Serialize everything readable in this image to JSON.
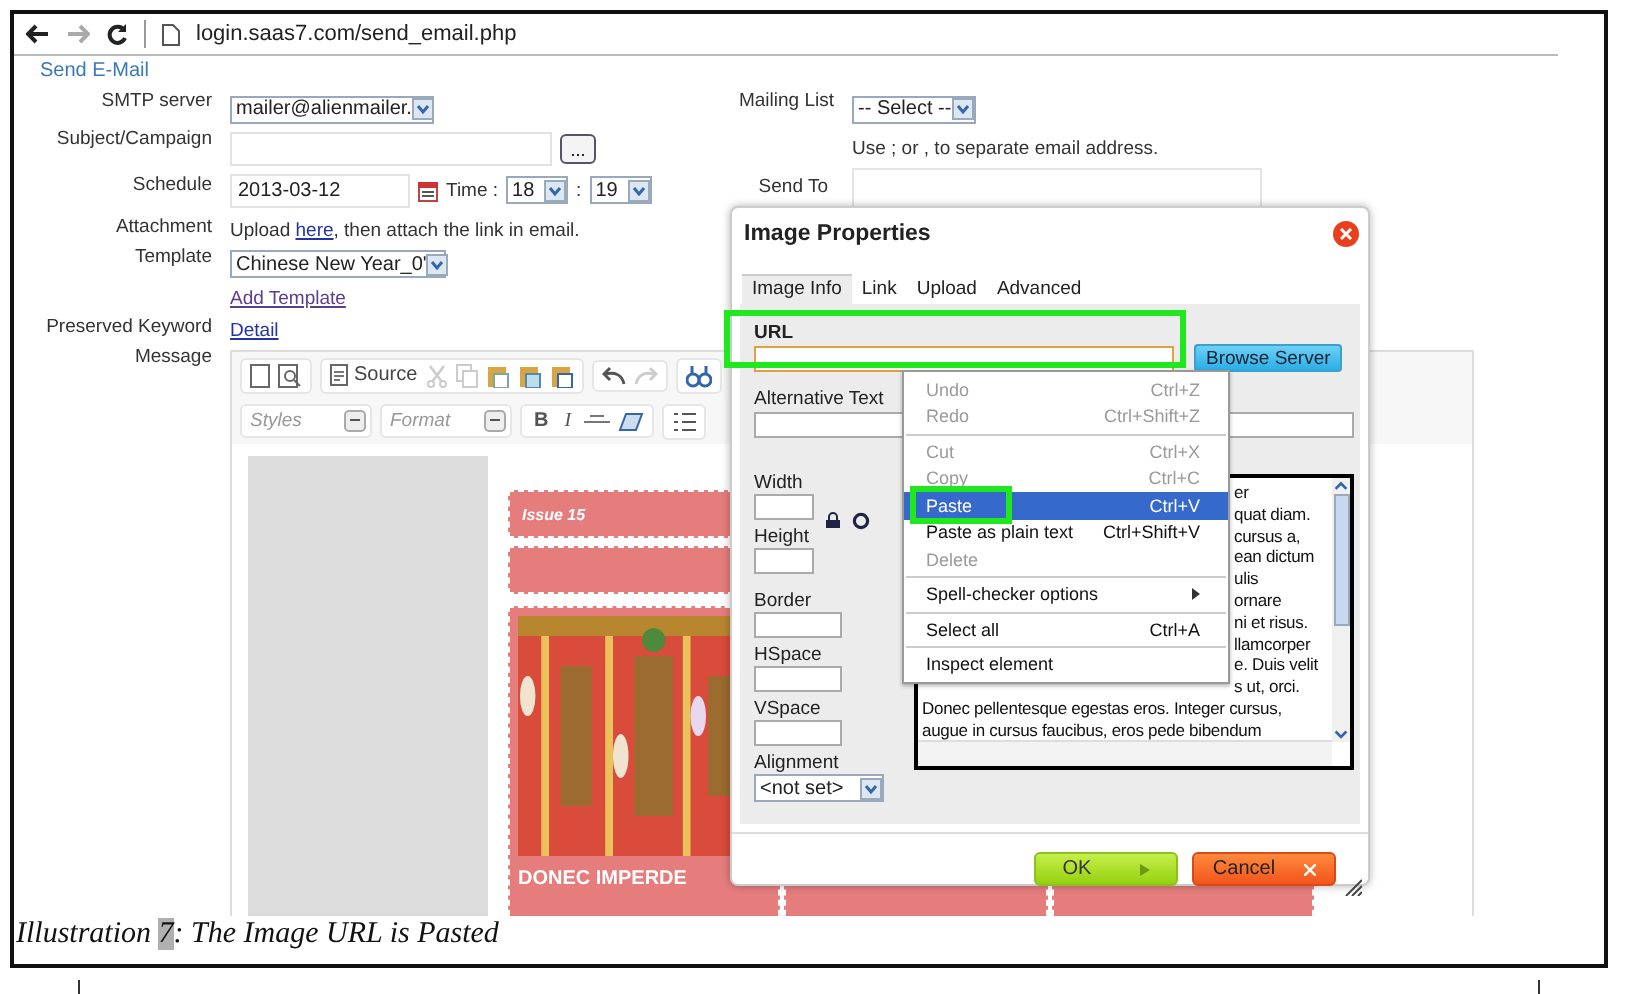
{
  "browser": {
    "url": "login.saas7.com/send_email.php"
  },
  "form": {
    "legend": "Send E-Mail",
    "smtp_server": {
      "label": "SMTP server",
      "value": "mailer@alienmailer."
    },
    "subject": {
      "label": "Subject/Campaign",
      "button": "..."
    },
    "schedule": {
      "label": "Schedule",
      "date": "2013-03-12",
      "time_label": "Time :",
      "hour": "18",
      "separator": ":",
      "minute": "19"
    },
    "attachment": {
      "label": "Attachment",
      "before": "Upload ",
      "link": "here",
      "after": ", then attach the link in email."
    },
    "template": {
      "label": "Template",
      "value": "Chinese New Year_0'",
      "link": "Add Template"
    },
    "preserved_keyword": {
      "label": "Preserved Keyword",
      "link": "Detail"
    },
    "message": {
      "label": "Message"
    },
    "mailing_list": {
      "label": "Mailing List",
      "value": "-- Select --"
    },
    "send_to": {
      "label": "Send To",
      "hint": "Use ; or , to separate email address."
    }
  },
  "editor": {
    "source_button": "Source",
    "styles": "Styles",
    "format": "Format",
    "bold": "B",
    "italic": "I",
    "issue": "Issue 15",
    "headline": "DONEC IMPERDE"
  },
  "dialog": {
    "title": "Image Properties",
    "tabs": [
      {
        "label": "Image Info",
        "selected": true
      },
      {
        "label": "Link",
        "selected": false
      },
      {
        "label": "Upload",
        "selected": false
      },
      {
        "label": "Advanced",
        "selected": false
      }
    ],
    "url": {
      "label": "URL",
      "highlighted": true
    },
    "browse_button": "Browse Server",
    "alt_text": {
      "label": "Alternative Text"
    },
    "width": {
      "label": "Width"
    },
    "height": {
      "label": "Height"
    },
    "border": {
      "label": "Border"
    },
    "hspace": {
      "label": "HSpace"
    },
    "vspace": {
      "label": "VSpace"
    },
    "alignment": {
      "label": "Alignment",
      "value": "<not set>"
    },
    "preview_lines": [
      {
        "kind": "partial",
        "text": "er"
      },
      {
        "kind": "partial",
        "text": "quat diam."
      },
      {
        "kind": "partial",
        "text": "cursus a,"
      },
      {
        "kind": "partial",
        "text": "ean dictum"
      },
      {
        "kind": "partial",
        "text": "ulis"
      },
      {
        "kind": "partial",
        "text": "ornare"
      },
      {
        "kind": "partial",
        "text": "ni et risus."
      },
      {
        "kind": "partial",
        "text": "llamcorper"
      },
      {
        "kind": "partial",
        "text": "e. Duis velit"
      },
      {
        "kind": "partial",
        "text": "s ut, orci."
      },
      {
        "kind": "full",
        "text": "Donec pellentesque egestas eros. Integer cursus,"
      },
      {
        "kind": "full",
        "text": "augue in cursus faucibus, eros pede bibendum"
      }
    ],
    "ok_button": "OK",
    "cancel_button": "Cancel"
  },
  "context_menu": {
    "items": [
      {
        "kind": "item",
        "label": "Undo",
        "shortcut": "Ctrl+Z",
        "disabled": true,
        "selected": false,
        "highlighted": false
      },
      {
        "kind": "item",
        "label": "Redo",
        "shortcut": "Ctrl+Shift+Z",
        "disabled": true,
        "selected": false,
        "highlighted": false
      },
      {
        "kind": "separator"
      },
      {
        "kind": "item",
        "label": "Cut",
        "shortcut": "Ctrl+X",
        "disabled": true,
        "selected": false,
        "highlighted": false
      },
      {
        "kind": "item",
        "label": "Copy",
        "shortcut": "Ctrl+C",
        "disabled": true,
        "selected": false,
        "highlighted": false
      },
      {
        "kind": "item",
        "label": "Paste",
        "shortcut": "Ctrl+V",
        "disabled": false,
        "selected": true,
        "highlighted": true
      },
      {
        "kind": "item",
        "label": "Paste as plain text",
        "shortcut": "Ctrl+Shift+V",
        "disabled": false,
        "selected": false,
        "highlighted": false
      },
      {
        "kind": "item",
        "label": "Delete",
        "disabled": true,
        "selected": false,
        "highlighted": false
      },
      {
        "kind": "separator"
      },
      {
        "kind": "submenu",
        "label": "Spell-checker options",
        "disabled": false,
        "selected": false,
        "highlighted": false
      },
      {
        "kind": "separator"
      },
      {
        "kind": "item",
        "label": "Select all",
        "shortcut": "Ctrl+A",
        "disabled": false,
        "selected": false,
        "highlighted": false
      },
      {
        "kind": "separator"
      },
      {
        "kind": "item",
        "label": "Inspect element",
        "disabled": false,
        "selected": false,
        "highlighted": false
      }
    ]
  },
  "caption": {
    "label": "Illustration",
    "number": "7",
    "text": ": The Image  URL is Pasted"
  }
}
